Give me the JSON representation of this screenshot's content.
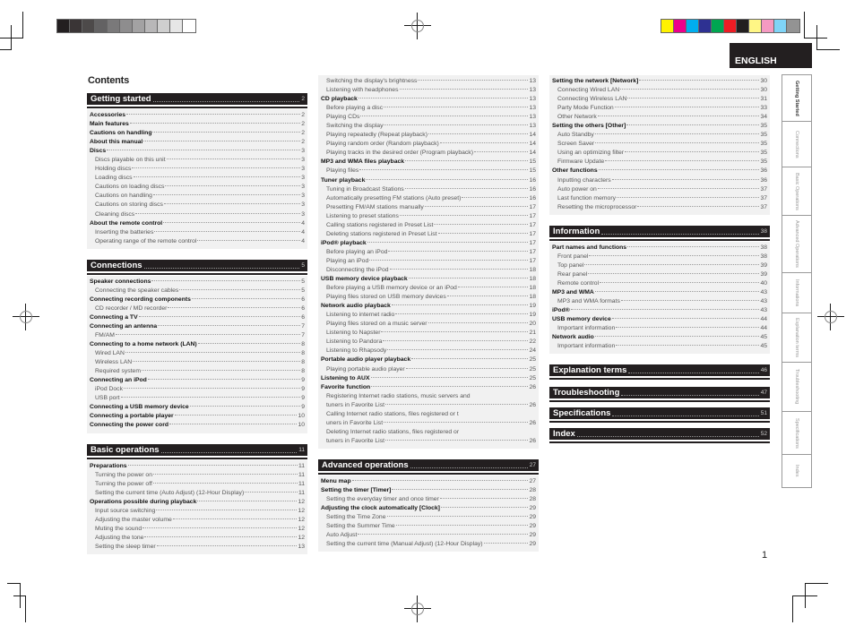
{
  "language_tab": "ENGLISH",
  "contents_title": "Contents",
  "page_number": "1",
  "color_bars": {
    "gray": [
      "#231f20",
      "#3a3536",
      "#4d4a4a",
      "#636263",
      "#7a797a",
      "#8e8d8e",
      "#a3a2a3",
      "#b8b7b8",
      "#cfcfcf",
      "#e6e6e6",
      "#ffffff"
    ],
    "color": [
      "#fff200",
      "#ec008c",
      "#00aeef",
      "#2e3192",
      "#00a651",
      "#ed1c24",
      "#231f20",
      "#fff685",
      "#f49ac1",
      "#7fd4f7",
      "#939393"
    ]
  },
  "side_tabs": [
    {
      "label": "Getting Started",
      "active": true
    },
    {
      "label": "Connections"
    },
    {
      "label": "Basic Operations"
    },
    {
      "label": "Advanced Operations"
    },
    {
      "label": "Informations"
    },
    {
      "label": "Explanation terms"
    },
    {
      "label": "Troubleshooting"
    },
    {
      "label": "Specifications"
    },
    {
      "label": "Index"
    }
  ],
  "columns": [
    [
      {
        "title": "Getting started",
        "page": "2",
        "items": [
          {
            "t": "Accessories",
            "p": "2",
            "b": true
          },
          {
            "t": "Main features",
            "p": "2",
            "b": true
          },
          {
            "t": "Cautions on handling",
            "p": "2",
            "b": true
          },
          {
            "t": "About this manual",
            "p": "2",
            "b": true
          },
          {
            "t": "Discs",
            "p": "3",
            "b": true
          },
          {
            "t": "Discs playable on this unit",
            "p": "3"
          },
          {
            "t": "Holding discs",
            "p": "3"
          },
          {
            "t": "Loading discs",
            "p": "3"
          },
          {
            "t": "Cautions on loading discs",
            "p": "3"
          },
          {
            "t": "Cautions on handling",
            "p": "3"
          },
          {
            "t": "Cautions on storing discs",
            "p": "3"
          },
          {
            "t": "Cleaning discs",
            "p": "3"
          },
          {
            "t": "About the remote control",
            "p": "4",
            "b": true
          },
          {
            "t": "Inserting the batteries",
            "p": "4"
          },
          {
            "t": "Operating range of the remote control",
            "p": "4"
          }
        ]
      },
      {
        "title": "Connections",
        "page": "5",
        "items": [
          {
            "t": "Speaker connections",
            "p": "5",
            "b": true
          },
          {
            "t": "Connecting the speaker cables",
            "p": "5"
          },
          {
            "t": "Connecting recording components",
            "p": "6",
            "b": true
          },
          {
            "t": "CD recorder / MD recorder",
            "p": "6"
          },
          {
            "t": "Connecting a TV",
            "p": "6",
            "b": true
          },
          {
            "t": "Connecting an antenna",
            "p": "7",
            "b": true
          },
          {
            "t": "FM/AM",
            "p": "7"
          },
          {
            "t": "Connecting to a home network (LAN)",
            "p": "8",
            "b": true
          },
          {
            "t": "Wired LAN",
            "p": "8"
          },
          {
            "t": "Wireless LAN",
            "p": "8"
          },
          {
            "t": "Required system",
            "p": "8"
          },
          {
            "t": " Connecting an iPod",
            "p": "9",
            "b": true
          },
          {
            "t": "iPod Dock",
            "p": "9"
          },
          {
            "t": "USB port",
            "p": "9"
          },
          {
            "t": "Connecting a USB memory device",
            "p": "9",
            "b": true
          },
          {
            "t": "Connecting a portable player",
            "p": "10",
            "b": true
          },
          {
            "t": "Connecting the power cord",
            "p": "10",
            "b": true
          }
        ]
      },
      {
        "title": "Basic operations",
        "page": "11",
        "items": [
          {
            "t": "Preparations",
            "p": "11",
            "b": true
          },
          {
            "t": "Turning the power on",
            "p": "11"
          },
          {
            "t": "Turning the power off",
            "p": "11"
          },
          {
            "t": "Setting the current time (Auto Adjust) (12-Hour Display)",
            "p": "11"
          },
          {
            "t": "Operations possible during playback",
            "p": "12",
            "b": true
          },
          {
            "t": "Input source switching",
            "p": "12"
          },
          {
            "t": "Adjusting the master volume",
            "p": "12"
          },
          {
            "t": "Muting the sound",
            "p": "12"
          },
          {
            "t": "Adjusting the tone",
            "p": "12"
          },
          {
            "t": "Setting the sleep timer",
            "p": "13"
          }
        ]
      }
    ],
    [
      {
        "title": null,
        "items": [
          {
            "t": "Switching the display's brightness",
            "p": "13"
          },
          {
            "t": "Listening with headphones",
            "p": "13"
          },
          {
            "t": "CD playback",
            "p": "13",
            "b": true
          },
          {
            "t": "Before playing a disc",
            "p": "13"
          },
          {
            "t": "Playing CDs",
            "p": "13"
          },
          {
            "t": "Switching the display",
            "p": "13"
          },
          {
            "t": "Playing repeatedly (Repeat playback)",
            "p": "14"
          },
          {
            "t": "Playing random order (Random playback)",
            "p": "14"
          },
          {
            "t": "Playing tracks in the desired order (Program playback)",
            "p": "14"
          },
          {
            "t": "MP3 and WMA files playback",
            "p": "15",
            "b": true
          },
          {
            "t": "Playing files",
            "p": "15"
          },
          {
            "t": "Tuner playback",
            "p": "16",
            "b": true
          },
          {
            "t": "Tuning in Broadcast Stations",
            "p": "16"
          },
          {
            "t": "Automatically presetting FM stations (Auto preset)",
            "p": "16"
          },
          {
            "t": "Presetting FM/AM stations manually",
            "p": "17"
          },
          {
            "t": "Listening to preset stations",
            "p": "17"
          },
          {
            "t": "Calling stations registered in Preset List",
            "p": "17"
          },
          {
            "t": "Deleting stations registered in Preset List",
            "p": "17"
          },
          {
            "t": "iPod® playback",
            "p": "17",
            "b": true
          },
          {
            "t": "Before playing an iPod",
            "p": "17"
          },
          {
            "t": "Playing an iPod",
            "p": "17"
          },
          {
            "t": "Disconnecting the iPod",
            "p": "18"
          },
          {
            "t": "USB memory device playback",
            "p": "18",
            "b": true
          },
          {
            "t": "Before playing a USB memory device or an iPod",
            "p": "18"
          },
          {
            "t": "Playing files stored on USB memory devices",
            "p": "18"
          },
          {
            "t": "Network audio playback",
            "p": "19",
            "b": true
          },
          {
            "t": "Listening to internet radio",
            "p": "19"
          },
          {
            "t": "Playing files stored on a music server",
            "p": "20"
          },
          {
            "t": "Listening to Napster",
            "p": "21"
          },
          {
            "t": "Listening to Pandora",
            "p": "22"
          },
          {
            "t": "Listening to Rhapsody",
            "p": "24"
          },
          {
            "t": "Portable audio player playback",
            "p": "25",
            "b": true
          },
          {
            "t": "Playing portable audio player",
            "p": "25"
          },
          {
            "t": "Listening to AUX",
            "p": "25",
            "b": true
          },
          {
            "t": "Favorite function",
            "p": "26",
            "b": true
          },
          {
            "t": "Registering Internet radio stations, music servers and",
            "p": "",
            "nop": true
          },
          {
            "t": "tuners in Favorite List",
            "p": "26"
          },
          {
            "t": "Calling Internet radio stations, files registered or t",
            "p": "",
            "nop": true
          },
          {
            "t": "uners in Favorite List",
            "p": "26"
          },
          {
            "t": "Deleting Internet radio stations, files registered or",
            "p": "",
            "nop": true
          },
          {
            "t": "tuners in Favorite List",
            "p": "26"
          }
        ]
      },
      {
        "title": "Advanced operations",
        "page": "27",
        "items": [
          {
            "t": "Menu map",
            "p": "27",
            "b": true
          },
          {
            "t": "Setting the timer [Timer]",
            "p": "28",
            "b": true
          },
          {
            "t": "Setting the everyday timer and once timer",
            "p": "28"
          },
          {
            "t": "Adjusting the clock automatically [Clock]",
            "p": "29",
            "b": true
          },
          {
            "t": "Setting the Time Zone",
            "p": "29"
          },
          {
            "t": "Setting the Summer Time",
            "p": "29"
          },
          {
            "t": "Auto Adjust",
            "p": "29"
          },
          {
            "t": "Setting the current time (Manual Adjust) (12-Hour Display)",
            "p": "29"
          }
        ]
      }
    ],
    [
      {
        "title": null,
        "items": [
          {
            "t": "Setting the network [Network]",
            "p": "30",
            "b": true
          },
          {
            "t": "Connecting Wired LAN",
            "p": "30"
          },
          {
            "t": "Connecting Wireless LAN",
            "p": "31"
          },
          {
            "t": "Party Mode Function",
            "p": "33"
          },
          {
            "t": "Other Network",
            "p": "34"
          },
          {
            "t": "Setting the others [Other]",
            "p": "35",
            "b": true
          },
          {
            "t": "Auto Standby",
            "p": "35"
          },
          {
            "t": "Screen Saver",
            "p": "35"
          },
          {
            "t": "Using an optimizing filter",
            "p": "35"
          },
          {
            "t": "Firmware Update",
            "p": "35"
          },
          {
            "t": "Other functions",
            "p": "36",
            "b": true
          },
          {
            "t": "Inputting characters",
            "p": "36"
          },
          {
            "t": "Auto power on",
            "p": "37"
          },
          {
            "t": "Last function memory",
            "p": "37"
          },
          {
            "t": "Resetting the microprocessor",
            "p": "37"
          }
        ]
      },
      {
        "title": "Information",
        "page": "38",
        "items": [
          {
            "t": "Part names and functions",
            "p": "38",
            "b": true
          },
          {
            "t": "Front panel",
            "p": "38"
          },
          {
            "t": "Top panel",
            "p": "39"
          },
          {
            "t": "Rear panel",
            "p": "39"
          },
          {
            "t": "Remote control",
            "p": "40"
          },
          {
            "t": "MP3 and WMA",
            "p": "43",
            "b": true
          },
          {
            "t": "MP3 and WMA formats",
            "p": "43"
          },
          {
            "t": "iPod®",
            "p": "43",
            "b": true
          },
          {
            "t": "USB memory device",
            "p": "44",
            "b": true
          },
          {
            "t": "Important information",
            "p": "44"
          },
          {
            "t": "Network audio",
            "p": "45",
            "b": true
          },
          {
            "t": "Important information",
            "p": "45"
          }
        ]
      },
      {
        "title": "Explanation terms",
        "page": "46",
        "items": []
      },
      {
        "title": "Troubleshooting",
        "page": "47",
        "items": []
      },
      {
        "title": "Specifications",
        "page": "51",
        "items": []
      },
      {
        "title": "Index",
        "page": "52",
        "items": []
      }
    ]
  ]
}
